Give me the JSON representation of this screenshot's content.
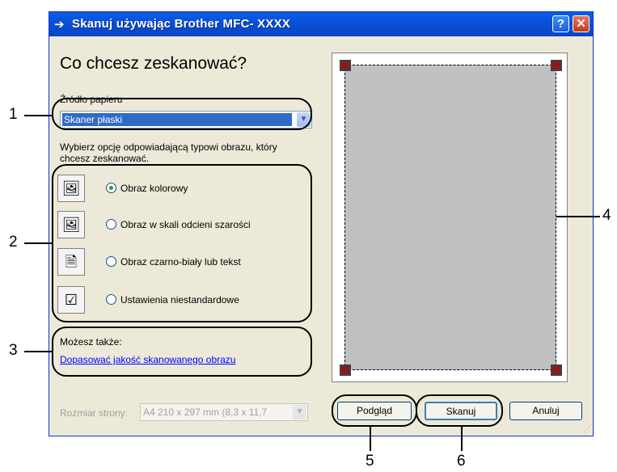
{
  "window": {
    "title": "Skanuj używając Brother MFC- XXXX",
    "help_label": "?",
    "close_label": "✕"
  },
  "heading": "Co chcesz zeskanować?",
  "source": {
    "label": "Źródło papieru",
    "value": "Skaner płaski"
  },
  "description": "Wybierz opcję odpowiadającą typowi obrazu, który chcesz zeskanować.",
  "options": [
    {
      "label": "Obraz kolorowy",
      "selected": true,
      "icon": "color-picture-icon"
    },
    {
      "label": "Obraz w skali odcieni szarości",
      "selected": false,
      "icon": "grayscale-picture-icon"
    },
    {
      "label": "Obraz czarno-biały lub tekst",
      "selected": false,
      "icon": "black-white-text-icon"
    },
    {
      "label": "Ustawienia niestandardowe",
      "selected": false,
      "icon": "custom-settings-icon"
    }
  ],
  "also": {
    "label": "Możesz także:",
    "link": "Dopasować jakość skanowanego obrazu"
  },
  "page_size": {
    "label": "Rozmiar strony:",
    "value": "A4 210 x 297 mm (8,3 x 11,7"
  },
  "buttons": {
    "preview": "Podgląd",
    "scan": "Skanuj",
    "cancel": "Anuluj"
  },
  "callouts": [
    "1",
    "2",
    "3",
    "4",
    "5",
    "6"
  ],
  "colors": {
    "titlebar": "#0a5ee6",
    "dialog_bg": "#ece9d8",
    "selection": "#316ac5",
    "preview_area": "#c0c0c0",
    "crop_handle": "#8b1a1a"
  }
}
